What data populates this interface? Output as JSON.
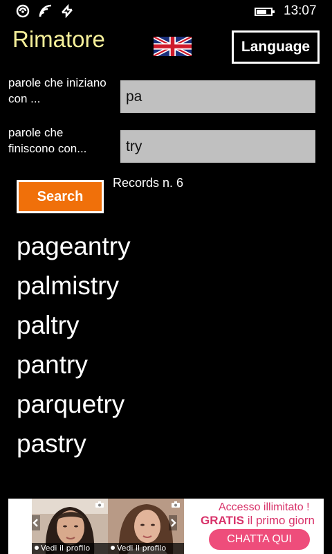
{
  "status_bar": {
    "time": "13:07",
    "icons": [
      "nfc-icon",
      "wifi-icon",
      "data-sync-icon",
      "battery-icon"
    ]
  },
  "header": {
    "app_title": "Rimatore",
    "flag": "uk-flag-icon",
    "language_button": "Language"
  },
  "form": {
    "starts_with_label": "parole che iniziano con ...",
    "starts_with_value": "pa",
    "ends_with_label": "parole che finiscono con...",
    "ends_with_value": "try",
    "search_button": "Search",
    "records_text": "Records n. 6"
  },
  "results": [
    "pageantry",
    "palmistry",
    "paltry",
    "pantry",
    "parquetry",
    "pastry"
  ],
  "ad": {
    "profile_label_1": "Vedi il profilo",
    "profile_label_2": "Vedi il profilo",
    "headline": "Accesso illimitato !",
    "subline_bold": "GRATIS",
    "subline_rest": " il primo giorn",
    "cta": "CHATTA QUI"
  },
  "colors": {
    "background": "#000000",
    "title": "#f6f09a",
    "search_button": "#f0700a",
    "input_background": "#c0c0c0",
    "ad_accent": "#ee4d7b"
  }
}
